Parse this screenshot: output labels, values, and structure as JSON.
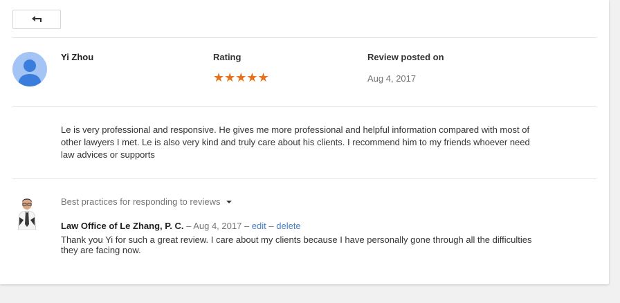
{
  "reviewer": {
    "name": "Yi Zhou"
  },
  "columns": {
    "rating_label": "Rating",
    "posted_label": "Review posted on"
  },
  "review": {
    "stars": "★★★★★",
    "rating_value": 5,
    "rating_max": 5,
    "date": "Aug 4, 2017",
    "text": "Le is very professional and responsive. He gives me more professional and helpful information compared with most of other lawyers I met. Le is also very kind and truly care about his clients. I recommend him to my friends whoever need law advices or supports"
  },
  "reply": {
    "best_practices_label": "Best practices for responding to reviews",
    "owner_name": "Law Office of Le Zhang, P. C.",
    "sep1": " – ",
    "date": "Aug 4, 2017",
    "sep2": " – ",
    "edit_label": "edit",
    "sep3": " – ",
    "delete_label": "delete",
    "text": "Thank you Yi for such a great review. I care about my clients because I have personally gone through all the difficulties they are facing now."
  },
  "colors": {
    "star": "#e7711b",
    "link": "#4a7fc9",
    "avatar_bg": "#a3c4f5",
    "avatar_fg": "#3b7ddd"
  },
  "icons": {
    "back": "arrow-back-icon",
    "avatar": "person-avatar-icon",
    "caret": "caret-down-icon"
  }
}
